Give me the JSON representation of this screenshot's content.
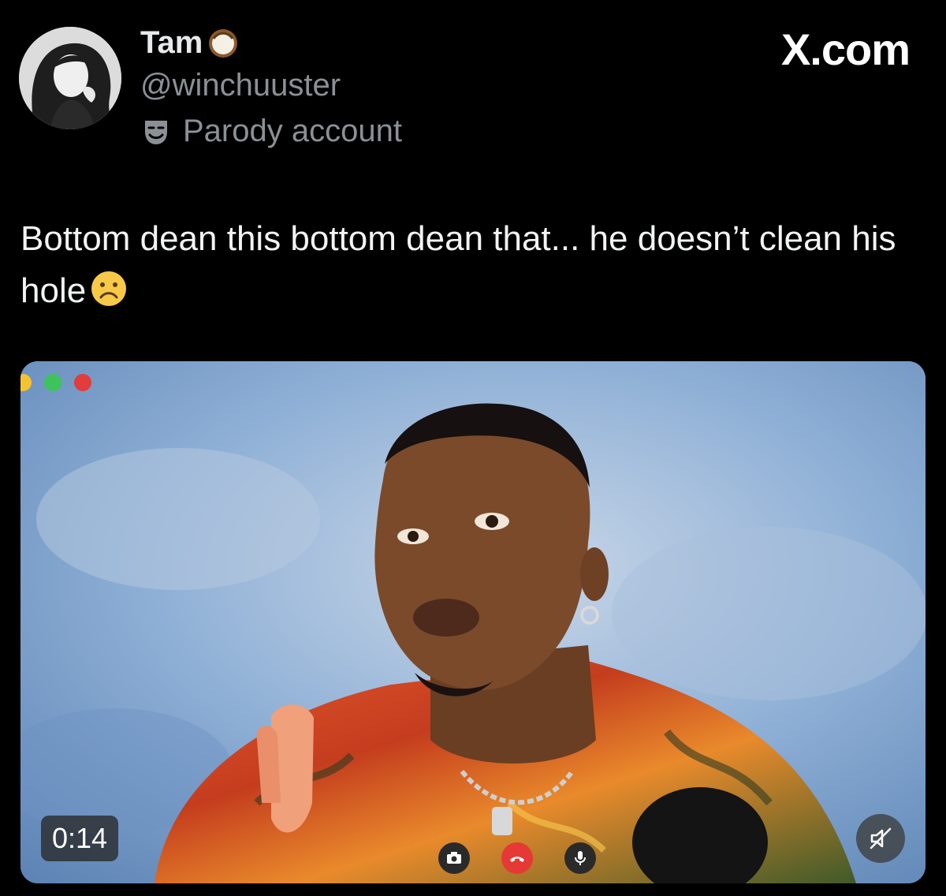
{
  "author": {
    "display_name": "Tam",
    "name_emoji": "coconut-icon",
    "handle": "@winchuuster",
    "parody_label": "Parody account",
    "parody_icon": "theater-mask-icon"
  },
  "site": {
    "label": "X.com"
  },
  "tweet": {
    "text": "Bottom dean this bottom dean that... he doesn’t clean his hole",
    "trailing_emoji": "frowning-face-icon"
  },
  "video": {
    "duration": "0:14",
    "window_dots": [
      "yellow",
      "green",
      "red"
    ],
    "controls": [
      "camera-flip-icon",
      "end-call-icon",
      "microphone-icon"
    ],
    "mute_icon": "speaker-muted-icon"
  },
  "colors": {
    "background": "#000000",
    "text_primary": "#e7e9ea",
    "text_secondary": "#8b9096",
    "end_call": "#e53935"
  }
}
